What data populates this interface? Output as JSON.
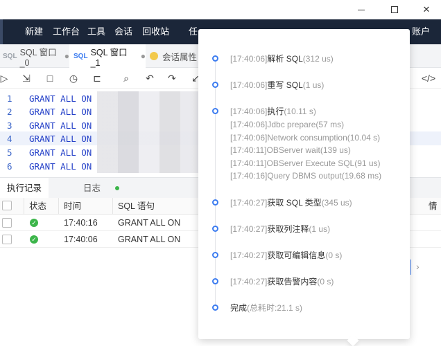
{
  "menubar": {
    "items": [
      "新建",
      "工作台",
      "工具",
      "会话",
      "回收站",
      "任"
    ],
    "right_label": "账户"
  },
  "tabs": [
    {
      "mark": "SQL",
      "label": "SQL 窗口_0"
    },
    {
      "mark": "SQL",
      "label": "SQL 窗口_1"
    },
    {
      "label": "会话属性"
    }
  ],
  "editor": {
    "lines": [
      {
        "num": "1",
        "code": "GRANT ALL ON"
      },
      {
        "num": "2",
        "code": "GRANT ALL ON"
      },
      {
        "num": "3",
        "code": "GRANT ALL ON"
      },
      {
        "num": "4",
        "code": "GRANT ALL ON"
      },
      {
        "num": "5",
        "code": "GRANT ALL ON"
      },
      {
        "num": "6",
        "code": "GRANT ALL ON"
      }
    ]
  },
  "bottom_tabs": {
    "history": "执行记录",
    "log": "日志"
  },
  "table": {
    "headers": {
      "status": "状态",
      "time": "时间",
      "sql": "SQL 语句",
      "right": "情"
    },
    "rows": [
      {
        "time": "17:40:16",
        "sql": "GRANT ALL ON"
      },
      {
        "time": "17:40:06",
        "sql": "GRANT ALL ON"
      }
    ]
  },
  "timeline": [
    {
      "ts": "[17:40:06]",
      "name": "解析 SQL",
      "dur": "(312 us)"
    },
    {
      "ts": "[17:40:06]",
      "name": "重写 SQL",
      "dur": "(1 us)"
    },
    {
      "ts": "[17:40:06]",
      "name": "执行",
      "dur": "(10.11 s)",
      "subs": [
        "[17:40:06]Jdbc prepare(57 ms)",
        "[17:40:06]Network consumption(10.04 s)",
        "[17:40:11]OBServer wait(139 us)",
        "[17:40:11]OBServer Execute SQL(91 us)",
        "[17:40:16]Query DBMS output(19.68 ms)"
      ]
    },
    {
      "ts": "[17:40:27]",
      "name": "获取 SQL 类型",
      "dur": "(345 us)"
    },
    {
      "ts": "[17:40:27]",
      "name": "获取列注释",
      "dur": "(1 us)"
    },
    {
      "ts": "[17:40:27]",
      "name": "获取可编辑信息",
      "dur": "(0 s)"
    },
    {
      "ts": "[17:40:27]",
      "name": "获取告警内容",
      "dur": "(0 s)"
    }
  ],
  "done": {
    "name": "完成",
    "total": "(总耗时:21.1 s)"
  },
  "colors": {
    "menubar": "#1b2639",
    "accent": "#3c7cf0",
    "success": "#3cb54a"
  }
}
